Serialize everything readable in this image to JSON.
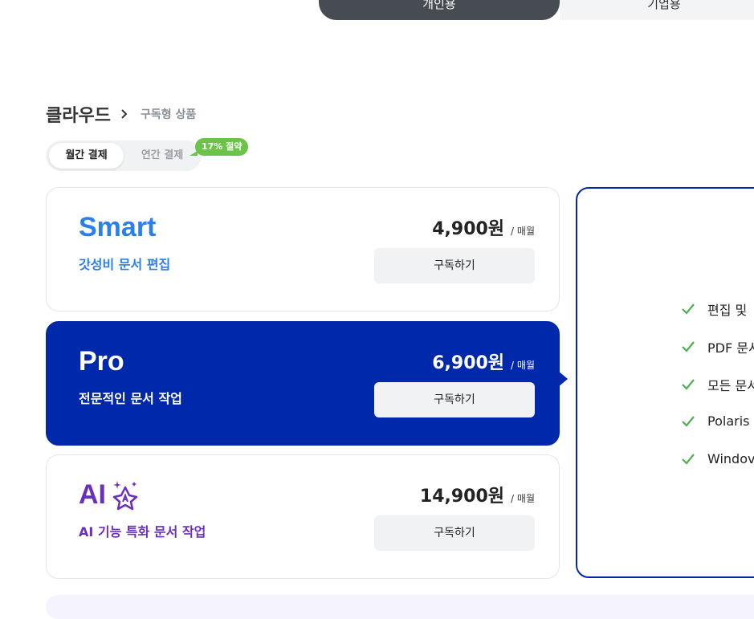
{
  "audience_tabs": {
    "personal": "개인용",
    "business": "기업용"
  },
  "breadcrumb": {
    "root": "클라우드",
    "current": "구독형 상품"
  },
  "billing": {
    "monthly": "월간 결제",
    "yearly": "연간 결제",
    "badge": "17% 절약"
  },
  "plans": [
    {
      "name": "Smart",
      "desc": "갓성비 문서 편집",
      "price": "4,900원",
      "unit": "/ 매월",
      "button": "구독하기"
    },
    {
      "name": "Pro",
      "desc": "전문적인 문서 작업",
      "price": "6,900원",
      "unit": "/ 매월",
      "button": "구독하기"
    },
    {
      "name": "AI",
      "desc": "AI 기능 특화 문서 작업",
      "price": "14,900원",
      "unit": "/ 매월",
      "button": "구독하기"
    }
  ],
  "features": [
    "편집 및",
    "PDF 문서",
    "모든 문서",
    "Polaris",
    "Windov"
  ],
  "colors": {
    "smart": "#2b7fe8",
    "pro": "#0028ab",
    "ai": "#6a2fbf",
    "check": "#4caf50"
  }
}
